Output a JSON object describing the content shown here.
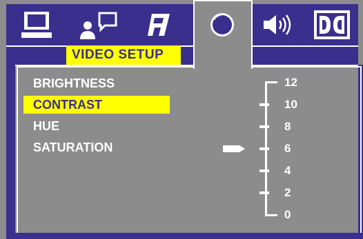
{
  "page": {
    "title": "VIDEO SETUP"
  },
  "tabs": [
    {
      "name": "general",
      "icon": "monitor-icon"
    },
    {
      "name": "language",
      "icon": "speaking-person-icon"
    },
    {
      "name": "audio",
      "icon": "music-note-icon"
    },
    {
      "name": "video",
      "icon": "color-circle-icon",
      "active": true
    },
    {
      "name": "speaker",
      "icon": "speaker-icon"
    },
    {
      "name": "dolby",
      "icon": "dolby-icon"
    }
  ],
  "menu": {
    "items": [
      "BRIGHTNESS",
      "CONTRAST",
      "HUE",
      "SATURATION"
    ],
    "selected_index": 1
  },
  "scale": {
    "labels": [
      "12",
      "10",
      "8",
      "6",
      "4",
      "2",
      "0"
    ],
    "current_value": 6
  },
  "colors": {
    "background": "#8c8c8c",
    "band": "#3a2f8c",
    "highlight": "#ffff00",
    "text": "#ffffff"
  }
}
